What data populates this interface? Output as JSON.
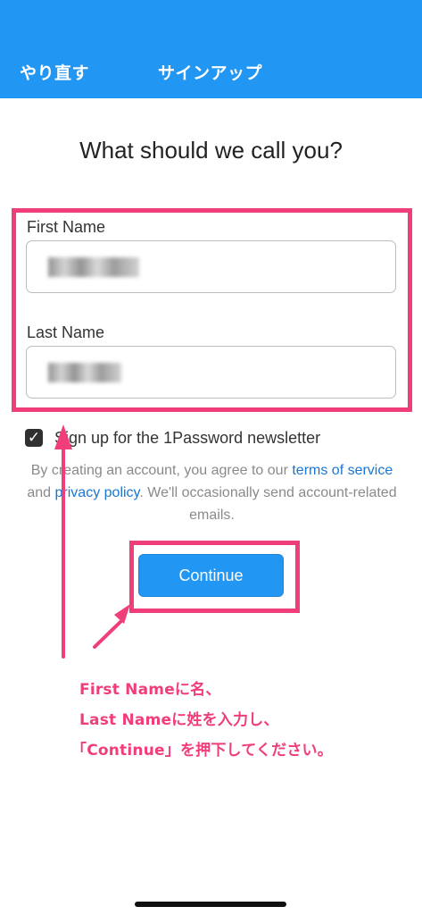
{
  "header": {
    "retry_label": "やり直す",
    "title": "サインアップ"
  },
  "page": {
    "heading": "What should we call you?"
  },
  "form": {
    "first_name_label": "First Name",
    "last_name_label": "Last Name",
    "checkbox_mark": "✓",
    "newsletter_label": "Sign up for the 1Password newsletter",
    "legal_before": "By creating an account, you agree to our ",
    "terms_link": "terms of service",
    "legal_middle": " and ",
    "privacy_link": "privacy policy",
    "legal_after": ". We'll occasionally send account-related emails.",
    "continue_label": "Continue"
  },
  "annotation": {
    "line1": "First Nameに名、",
    "line2": "Last Nameに姓を入力し、",
    "line3": "「Continue」を押下してください。"
  },
  "colors": {
    "primary": "#2196f3",
    "highlight": "#ef3e79"
  }
}
